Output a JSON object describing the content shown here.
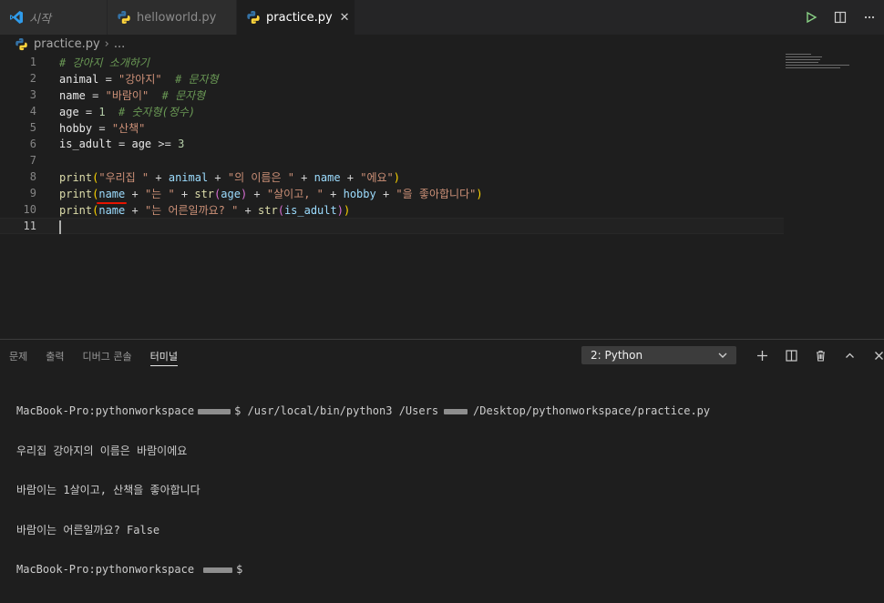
{
  "tabs": [
    {
      "label": "시작",
      "icon": "vscode-logo-icon",
      "active": false
    },
    {
      "label": "helloworld.py",
      "icon": "python-icon",
      "active": false
    },
    {
      "label": "practice.py",
      "icon": "python-icon",
      "active": true,
      "close": "✕"
    }
  ],
  "breadcrumb": {
    "file": "practice.py",
    "separator": "›",
    "more": "..."
  },
  "editor": {
    "line_numbers": [
      "1",
      "2",
      "3",
      "4",
      "5",
      "6",
      "7",
      "8",
      "9",
      "10",
      "11"
    ],
    "lines": [
      [
        {
          "t": "# 강아지 소개하기",
          "c": "cm"
        }
      ],
      [
        {
          "t": "animal",
          "c": "idw"
        },
        {
          "t": " = ",
          "c": "op"
        },
        {
          "t": "\"강아지\"",
          "c": "str"
        },
        {
          "t": "  # 문자형",
          "c": "cm"
        }
      ],
      [
        {
          "t": "name",
          "c": "idw"
        },
        {
          "t": " = ",
          "c": "op"
        },
        {
          "t": "\"바람이\"",
          "c": "str"
        },
        {
          "t": "  # 문자형",
          "c": "cm"
        }
      ],
      [
        {
          "t": "age",
          "c": "idw"
        },
        {
          "t": " = ",
          "c": "op"
        },
        {
          "t": "1",
          "c": "num"
        },
        {
          "t": "  # 숫자형(정수)",
          "c": "cm"
        }
      ],
      [
        {
          "t": "hobby",
          "c": "idw"
        },
        {
          "t": " = ",
          "c": "op"
        },
        {
          "t": "\"산책\"",
          "c": "str"
        }
      ],
      [
        {
          "t": "is_adult",
          "c": "idw"
        },
        {
          "t": " = ",
          "c": "op"
        },
        {
          "t": "age",
          "c": "idw"
        },
        {
          "t": " >= ",
          "c": "op"
        },
        {
          "t": "3",
          "c": "num"
        }
      ],
      [],
      [
        {
          "t": "print",
          "c": "fn"
        },
        {
          "t": "(",
          "c": "p1"
        },
        {
          "t": "\"우리집 \"",
          "c": "str"
        },
        {
          "t": " + ",
          "c": "op"
        },
        {
          "t": "animal",
          "c": "id"
        },
        {
          "t": " + ",
          "c": "op"
        },
        {
          "t": "\"의 이름은 \"",
          "c": "str"
        },
        {
          "t": " + ",
          "c": "op"
        },
        {
          "t": "name",
          "c": "id"
        },
        {
          "t": " + ",
          "c": "op"
        },
        {
          "t": "\"에요\"",
          "c": "str"
        },
        {
          "t": ")",
          "c": "p1"
        }
      ],
      [
        {
          "t": "print",
          "c": "fn"
        },
        {
          "t": "(",
          "c": "p1"
        },
        {
          "t": "name",
          "c": "id",
          "err": true
        },
        {
          "t": " + ",
          "c": "op"
        },
        {
          "t": "\"는 \"",
          "c": "str"
        },
        {
          "t": " + ",
          "c": "op"
        },
        {
          "t": "str",
          "c": "fn"
        },
        {
          "t": "(",
          "c": "p2"
        },
        {
          "t": "age",
          "c": "id"
        },
        {
          "t": ")",
          "c": "p2"
        },
        {
          "t": " + ",
          "c": "op"
        },
        {
          "t": "\"살이고, \"",
          "c": "str"
        },
        {
          "t": " + ",
          "c": "op"
        },
        {
          "t": "hobby",
          "c": "id"
        },
        {
          "t": " + ",
          "c": "op"
        },
        {
          "t": "\"을 좋아합니다\"",
          "c": "str"
        },
        {
          "t": ")",
          "c": "p1"
        }
      ],
      [
        {
          "t": "print",
          "c": "fn"
        },
        {
          "t": "(",
          "c": "p1"
        },
        {
          "t": "name",
          "c": "id",
          "err": true
        },
        {
          "t": " + ",
          "c": "op"
        },
        {
          "t": "\"는 어른일까요? \"",
          "c": "str"
        },
        {
          "t": " + ",
          "c": "op"
        },
        {
          "t": "str",
          "c": "fn"
        },
        {
          "t": "(",
          "c": "p2"
        },
        {
          "t": "is_adult",
          "c": "id"
        },
        {
          "t": ")",
          "c": "p2"
        },
        {
          "t": ")",
          "c": "p1"
        }
      ],
      []
    ]
  },
  "panel": {
    "tabs": [
      "문제",
      "출력",
      "디버그 콘솔",
      "터미널"
    ],
    "active_tab": "터미널",
    "terminal_select": "2: Python",
    "terminal": {
      "prompt_host": "MacBook-Pro:pythonworkspace",
      "command_suffix": "$ /usr/local/bin/python3 /Users",
      "path_suffix": "/Desktop/pythonworkspace/practice.py",
      "output": [
        "우리집 강아지의 이름은 바람이에요",
        "바람이는 1살이고, 산책을 좋아합니다",
        "바람이는 어른일까요? False"
      ],
      "last_prompt_suffix": "$"
    }
  },
  "colors": {
    "accent": "#007acc",
    "error": "#e51400",
    "python_blue": "#3572a5",
    "python_yellow": "#ffd43b"
  }
}
